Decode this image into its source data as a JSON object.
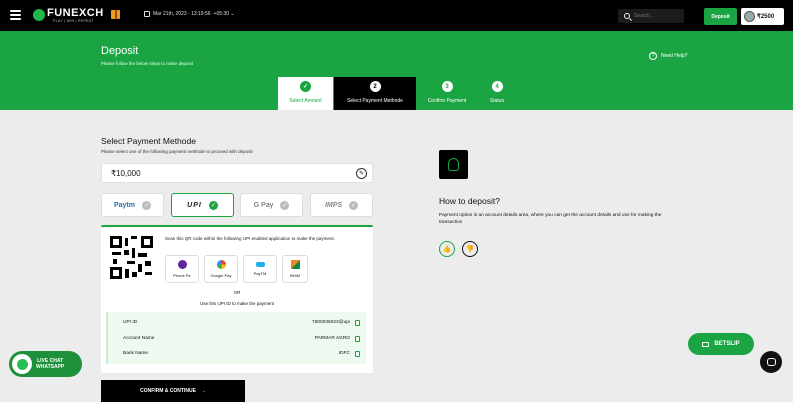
{
  "header": {
    "logo_text": "FUNEXCH",
    "logo_tagline": "PLAY | WIN | REPEAT",
    "datetime": "Mar 21th, 2023 - 13:19:56",
    "timezone": "+05:30",
    "search_placeholder": "Search...",
    "deposit_label": "Deposit",
    "balance": "₹2500"
  },
  "hero": {
    "title": "Deposit",
    "subtitle": "Please follow the below steps to make deposit",
    "help_label": "Need Help?"
  },
  "steps": [
    {
      "num": "✓",
      "label": "Select Amount"
    },
    {
      "num": "2",
      "label": "Select Payment Methode"
    },
    {
      "num": "3",
      "label": "Confirm Payment"
    },
    {
      "num": "4",
      "label": "Status"
    }
  ],
  "payment": {
    "title": "Select Payment Methode",
    "subtitle": "Please select one of the following payment methode to proceed with deposit",
    "amount": "₹10,000",
    "methods": [
      "Paytm",
      "UPI",
      "G Pay",
      "IMPS"
    ],
    "selected_method": "UPI",
    "scan_text": "Scan this QR code within the following UPI enabled application to make the payment.",
    "apps": [
      "Phone Pe",
      "Google Pay",
      "PayTM",
      "BHIM"
    ],
    "or_text": "OR",
    "upi_note": "Use this UPI ID to make the payment",
    "details": [
      {
        "key": "UPI ID",
        "value": "7600036023@upi"
      },
      {
        "key": "Account Name",
        "value": "PARMAR AGRO"
      },
      {
        "key": "Bank Name",
        "value": "IDFC"
      }
    ],
    "confirm_label": "CONFIRM & CONTINUE"
  },
  "info": {
    "title": "How to deposit?",
    "text": "Payment option is an account details area, where you can get the account details and use for making the transaction"
  },
  "floating": {
    "betslip": "BETSLIP",
    "whatsapp_line1": "LIVE CHAT",
    "whatsapp_line2": "WHATSAPP"
  },
  "colors": {
    "brand": "#1aa542",
    "topbar": "#000000",
    "background": "#ececec"
  }
}
